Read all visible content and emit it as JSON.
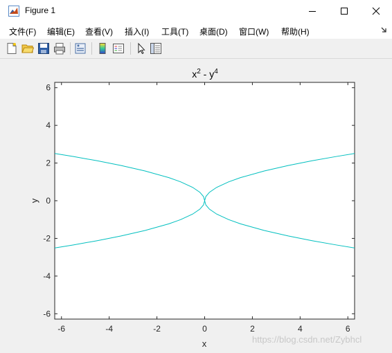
{
  "window": {
    "title": "Figure 1",
    "controls": [
      "minimize",
      "maximize",
      "close"
    ]
  },
  "menu": {
    "items": [
      {
        "label": "文件(F)"
      },
      {
        "label": "编辑(E)"
      },
      {
        "label": "查看(V)"
      },
      {
        "label": "插入(I)"
      },
      {
        "label": "工具(T)"
      },
      {
        "label": "桌面(D)"
      },
      {
        "label": "窗口(W)"
      },
      {
        "label": "帮助(H)"
      }
    ],
    "overflow_icon": "dock-arrow-icon"
  },
  "toolbar": {
    "buttons": [
      {
        "icon": "new-figure-icon"
      },
      {
        "icon": "open-file-icon"
      },
      {
        "icon": "save-icon"
      },
      {
        "icon": "print-icon"
      },
      {
        "icon": "link-plot-icon"
      },
      {
        "icon": "insert-colorbar-icon"
      },
      {
        "icon": "insert-legend-icon"
      },
      {
        "icon": "edit-plot-pointer-icon"
      },
      {
        "icon": "property-inspector-icon"
      }
    ]
  },
  "chart_data": {
    "type": "line",
    "title": "x² - y⁴",
    "title_base": "x",
    "title_sup1": "2",
    "title_mid": " - y",
    "title_sup2": "4",
    "xlabel": "x",
    "ylabel": "y",
    "xlim": [
      -6.2832,
      6.2832
    ],
    "ylim": [
      -6.2832,
      6.2832
    ],
    "xticks": [
      -6,
      -4,
      -2,
      0,
      2,
      4,
      6
    ],
    "yticks": [
      -6,
      -4,
      -2,
      0,
      2,
      4,
      6
    ],
    "xtick_labels": [
      "-6",
      "-4",
      "-2",
      "0",
      "2",
      "4",
      "6"
    ],
    "ytick_labels": [
      "-6",
      "-4",
      "-2",
      "0",
      "2",
      "4",
      "6"
    ],
    "grid": false,
    "series": [
      {
        "color": "#00bfbf",
        "curve": "x^2 - y^4 = 0",
        "branches": [
          {
            "x": [
              -6.283,
              -5.5,
              -4.5,
              -3.5,
              -2.5,
              -1.5,
              -1.0,
              -0.5,
              -0.2,
              -0.05,
              0.0
            ],
            "y": [
              2.507,
              2.345,
              2.121,
              1.871,
              1.581,
              1.225,
              1.0,
              0.707,
              0.447,
              0.224,
              0.0
            ]
          },
          {
            "x": [
              0.0,
              0.05,
              0.2,
              0.5,
              1.0,
              1.5,
              2.5,
              3.5,
              4.5,
              5.5,
              6.283
            ],
            "y": [
              0.0,
              0.224,
              0.447,
              0.707,
              1.0,
              1.225,
              1.581,
              1.871,
              2.121,
              2.345,
              2.507
            ]
          },
          {
            "x": [
              -6.283,
              -5.5,
              -4.5,
              -3.5,
              -2.5,
              -1.5,
              -1.0,
              -0.5,
              -0.2,
              -0.05,
              0.0
            ],
            "y": [
              -2.507,
              -2.345,
              -2.121,
              -1.871,
              -1.581,
              -1.225,
              -1.0,
              -0.707,
              -0.447,
              -0.224,
              0.0
            ]
          },
          {
            "x": [
              0.0,
              0.05,
              0.2,
              0.5,
              1.0,
              1.5,
              2.5,
              3.5,
              4.5,
              5.5,
              6.283
            ],
            "y": [
              0.0,
              -0.224,
              -0.447,
              -0.707,
              -1.0,
              -1.225,
              -1.581,
              -1.871,
              -2.121,
              -2.345,
              -2.507
            ]
          }
        ]
      }
    ]
  },
  "watermark": "https://blog.csdn.net/Zybhcl"
}
